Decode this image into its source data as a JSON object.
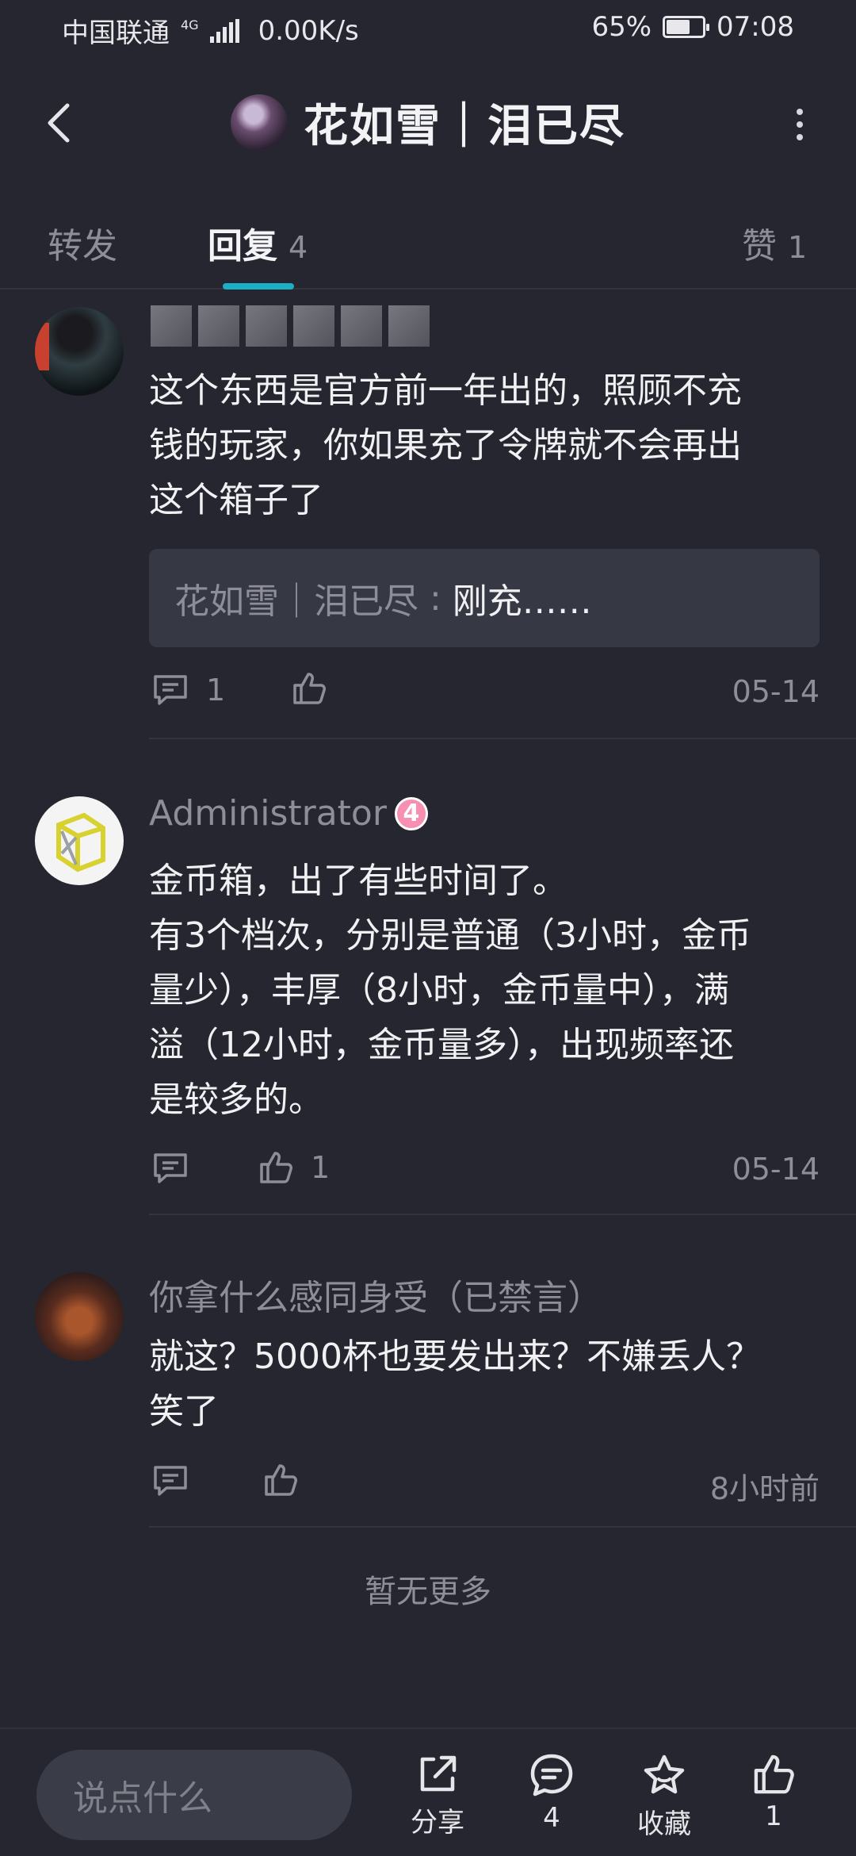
{
  "status_bar": {
    "carrier": "中国联通",
    "network": "4G",
    "speed": "0.00K/s",
    "battery": "65%",
    "time": "07:08"
  },
  "header": {
    "title": "花如雪｜泪已尽",
    "back_icon": "chevron-left-icon",
    "more_icon": "more-vertical-icon"
  },
  "tabs": {
    "repost": {
      "label": "转发"
    },
    "reply": {
      "label": "回复",
      "count": "4"
    },
    "likes": {
      "label": "赞",
      "count": "1"
    }
  },
  "comments": [
    {
      "name": "",
      "name_obscured": true,
      "text_lines": [
        "这个东西是官方前一年出的，照顾不充",
        "钱的玩家，你如果充了令牌就不会再出",
        "这个箱子了"
      ],
      "quote": {
        "author": "花如雪｜泪已尽",
        "separator": " : ",
        "message": "刚充……"
      },
      "reply_count": "1",
      "like_count": "",
      "time": "05-14"
    },
    {
      "name": "Administrator",
      "badge": "4",
      "text_lines": [
        "金币箱，出了有些时间了。",
        "有3个档次，分别是普通（3小时，金币",
        "量少），丰厚（8小时，金币量中），满",
        "溢（12小时，金币量多），出现频率还",
        "是较多的。"
      ],
      "reply_count": "",
      "like_count": "1",
      "time": "05-14"
    },
    {
      "name": "你拿什么感同身受（已禁言）",
      "text_lines": [
        "就这？5000杯也要发出来？不嫌丢人？",
        "笑了"
      ],
      "reply_count": "",
      "like_count": "",
      "time": "8小时前"
    }
  ],
  "no_more": "暂无更多",
  "bottom_bar": {
    "input_placeholder": "说点什么",
    "share_label": "分享",
    "comment_count": "4",
    "favorite_label": "收藏",
    "like_count": "1"
  },
  "colors": {
    "background": "#25262f",
    "accent": "#1bb0c6",
    "muted_text": "#8d8e98",
    "badge": "#f78fb3"
  }
}
